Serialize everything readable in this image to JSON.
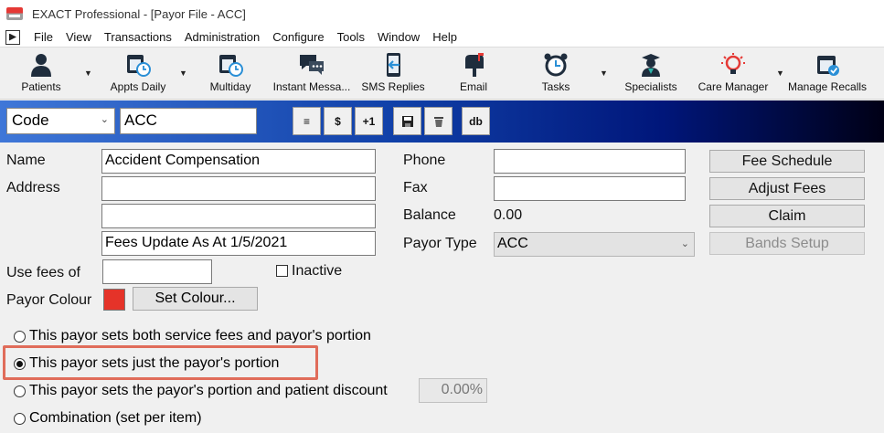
{
  "window": {
    "title": "EXACT Professional - [Payor File - ACC]"
  },
  "menu": [
    "File",
    "View",
    "Transactions",
    "Administration",
    "Configure",
    "Tools",
    "Window",
    "Help"
  ],
  "toolbar": {
    "items": [
      {
        "label": "Patients",
        "icon": "patient-icon"
      },
      {
        "label": "Appts Daily",
        "icon": "calendar-clock-icon"
      },
      {
        "label": "Multiday",
        "icon": "calendar-clock-icon"
      },
      {
        "label": "Instant Messa...",
        "icon": "chat-icon"
      },
      {
        "label": "SMS Replies",
        "icon": "sms-icon"
      },
      {
        "label": "Email",
        "icon": "mailbox-icon"
      },
      {
        "label": "Tasks",
        "icon": "alarm-clock-icon"
      },
      {
        "label": "Specialists",
        "icon": "specialist-icon"
      },
      {
        "label": "Care Manager",
        "icon": "lightbulb-icon"
      },
      {
        "label": "Manage Recalls",
        "icon": "calendar-check-icon"
      }
    ]
  },
  "record_bar": {
    "search_field": "Code",
    "search_value": "ACC",
    "buttons": [
      "≡",
      "$",
      "+1",
      "💾",
      "🗑",
      "db"
    ]
  },
  "form": {
    "name_label": "Name",
    "name_value": "Accident Compensation",
    "address_label": "Address",
    "address_line1": "",
    "address_line2": "",
    "address_line3": "Fees Update As At 1/5/2021",
    "use_fees_label": "Use fees of",
    "use_fees_value": "",
    "inactive_label": "Inactive",
    "payor_colour_label": "Payor Colour",
    "payor_colour": "#e53329",
    "set_colour_label": "Set Colour...",
    "phone_label": "Phone",
    "phone_value": "",
    "fax_label": "Fax",
    "fax_value": "",
    "balance_label": "Balance",
    "balance_value": "0.00",
    "payor_type_label": "Payor Type",
    "payor_type_value": "ACC"
  },
  "side_buttons": {
    "fee_schedule": "Fee Schedule",
    "adjust_fees": "Adjust Fees",
    "claim": "Claim",
    "bands_setup": "Bands Setup"
  },
  "options": {
    "items": [
      "This payor sets both service fees and payor's portion",
      "This payor sets just the payor's portion",
      "This payor sets the payor's portion and patient discount",
      "Combination (set per item)"
    ],
    "selected_index": 1,
    "discount_value": "0.00%"
  }
}
